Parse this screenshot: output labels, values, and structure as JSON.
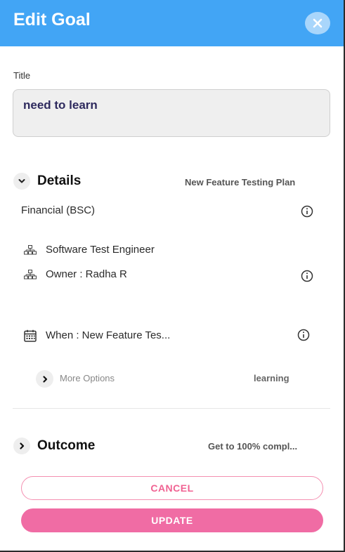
{
  "header": {
    "title": "Edit Goal",
    "background": "#42a5f5",
    "close_icon": "close-icon"
  },
  "title_field": {
    "label": "Title",
    "value": "need to learn"
  },
  "details": {
    "heading": "Details",
    "plan": "New Feature Testing Plan",
    "category": "Financial (BSC)",
    "role": "Software Test Engineer",
    "owner": "Owner : Radha R",
    "when": "When : New Feature Tes...",
    "more_options_label": "More Options",
    "more_options_tag": "learning",
    "icons": {
      "info": "info-icon",
      "org": "org-chart-icon",
      "calendar": "calendar-icon",
      "chevron_down": "chevron-down-icon",
      "chevron_right": "chevron-right-icon"
    }
  },
  "outcome": {
    "heading": "Outcome",
    "summary": "Get to 100% compl..."
  },
  "buttons": {
    "cancel": "CANCEL",
    "update": "UPDATE",
    "accent": "#f06ca4"
  }
}
